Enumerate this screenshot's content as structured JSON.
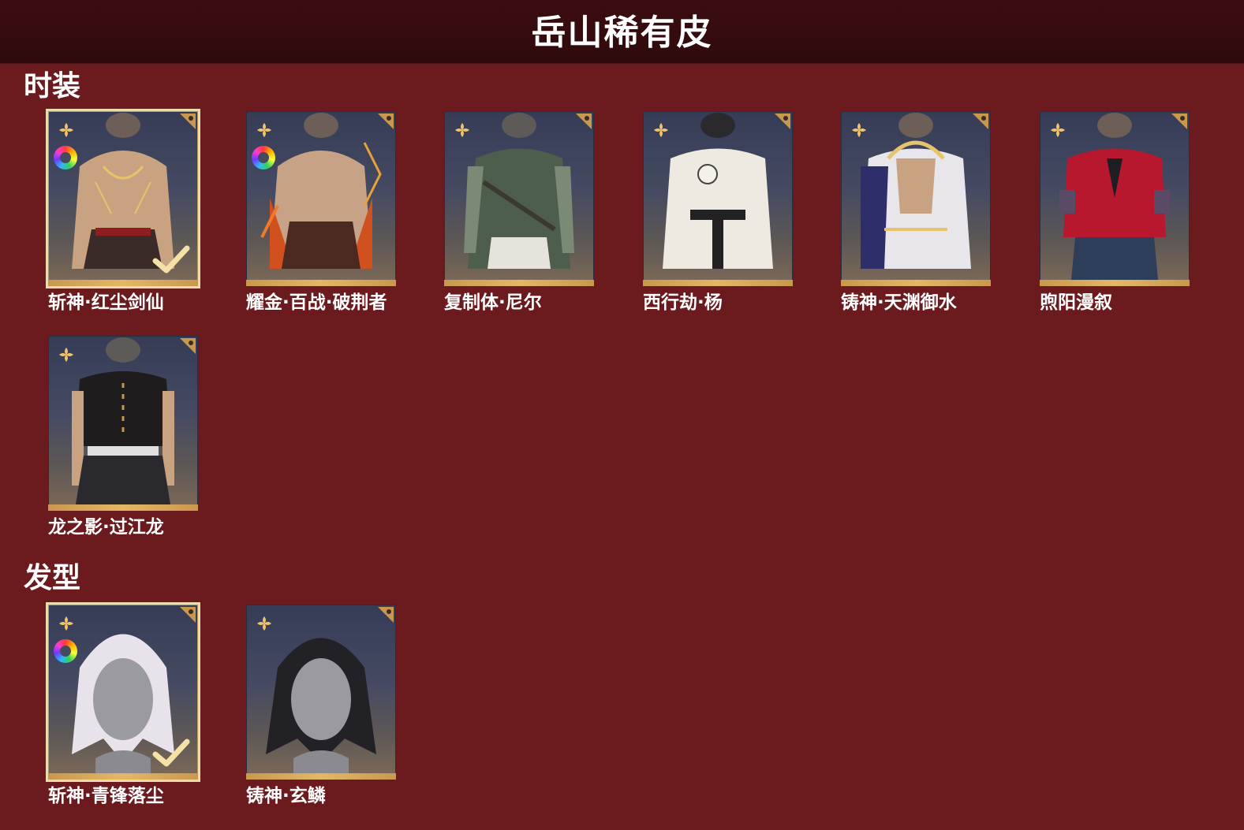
{
  "header": {
    "title": "岳山稀有皮"
  },
  "sections": [
    {
      "title": "时装",
      "items": [
        {
          "name": "斩神·红尘剑仙",
          "selected": true,
          "dyeable": true
        },
        {
          "name": "耀金·百战·破荆者",
          "selected": false,
          "dyeable": true
        },
        {
          "name": "复制体·尼尔",
          "selected": false,
          "dyeable": false
        },
        {
          "name": "西行劫·杨",
          "selected": false,
          "dyeable": false
        },
        {
          "name": "铸神·天渊御水",
          "selected": false,
          "dyeable": false
        },
        {
          "name": "煦阳漫叙",
          "selected": false,
          "dyeable": false
        },
        {
          "name": "龙之影·过江龙",
          "selected": false,
          "dyeable": false
        }
      ]
    },
    {
      "title": "发型",
      "items": [
        {
          "name": "斩神·青锋落尘",
          "selected": true,
          "dyeable": true
        },
        {
          "name": "铸神·玄鳞",
          "selected": false,
          "dyeable": false
        }
      ]
    }
  ],
  "colors": {
    "background": "#6b1a1e",
    "header": "#340b0e",
    "accent_gold": "#e4b766",
    "selected_border": "#e9dcae"
  },
  "icons": {
    "rarity": "four-petal-flower-icon",
    "corner": "corner-badge-icon",
    "dye": "color-wheel-icon",
    "equipped": "checkmark-icon",
    "outfit_preview": "outfit-figure-icon",
    "hair_preview": "hairstyle-head-icon"
  }
}
